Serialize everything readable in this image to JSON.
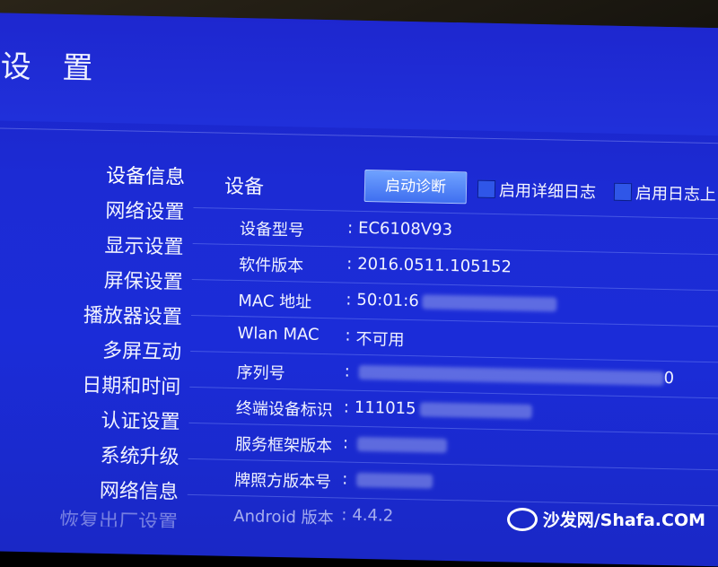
{
  "header": {
    "title": "设 置"
  },
  "sidebar": {
    "items": [
      {
        "label": "设备信息"
      },
      {
        "label": "网络设置"
      },
      {
        "label": "显示设置"
      },
      {
        "label": "屏保设置"
      },
      {
        "label": "播放器设置"
      },
      {
        "label": "多屏互动"
      },
      {
        "label": "日期和时间"
      },
      {
        "label": "认证设置"
      },
      {
        "label": "系统升级"
      },
      {
        "label": "网络信息"
      },
      {
        "label": "恢复出厂设置"
      }
    ]
  },
  "main": {
    "section_label": "设备",
    "diagnose_button": "启动诊断",
    "verbose_log_checkbox": "启用详细日志",
    "log_checkbox": "启用日志上",
    "rows": [
      {
        "label": "设备型号",
        "value": "EC6108V93"
      },
      {
        "label": "软件版本",
        "value": "2016.0511.105152"
      },
      {
        "label": "MAC 地址",
        "value": "50:01:6"
      },
      {
        "label": "Wlan MAC",
        "value": "不可用"
      },
      {
        "label": "序列号",
        "value": "0"
      },
      {
        "label": "终端设备标识",
        "value": "111015"
      },
      {
        "label": "服务框架版本",
        "value": ""
      },
      {
        "label": "牌照方版本号",
        "value": ""
      },
      {
        "label": "Android 版本",
        "value": "4.4.2"
      }
    ]
  },
  "watermark": {
    "text": "沙发网/Shafa.COM"
  }
}
